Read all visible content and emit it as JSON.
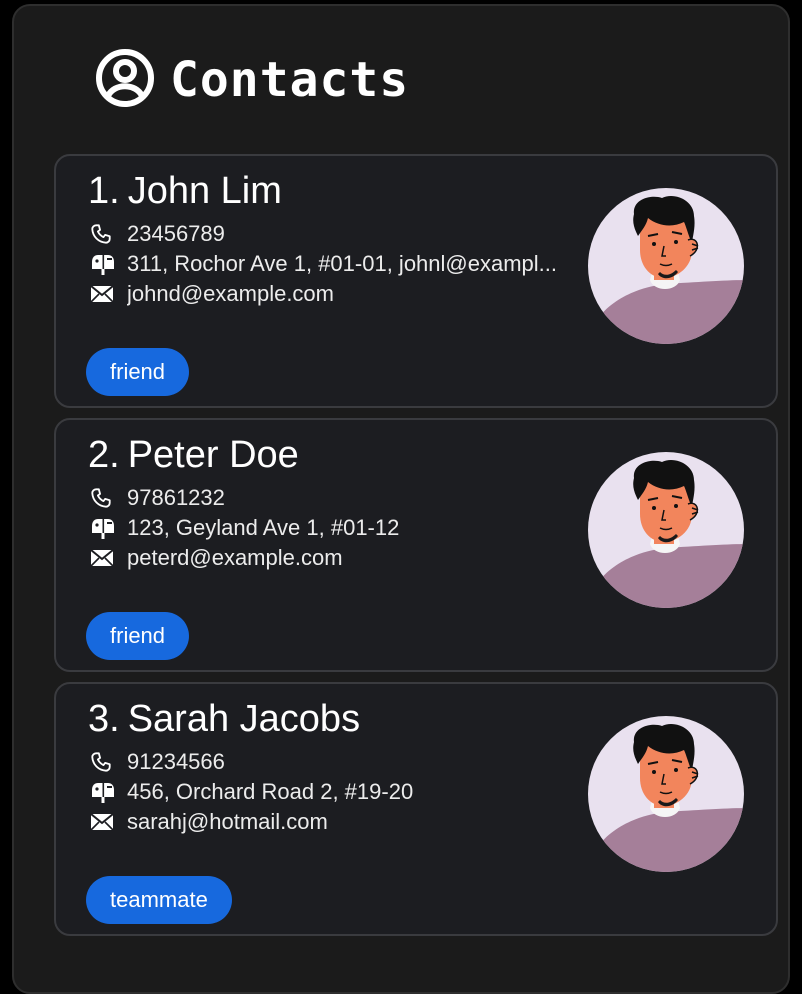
{
  "header": {
    "title": "Contacts",
    "icon": "user-circle-icon"
  },
  "contacts": [
    {
      "index": "1.",
      "name": "John Lim",
      "phone": "23456789",
      "address": "311, Rochor Ave 1, #01-01, johnl@exampl...",
      "email": "johnd@example.com",
      "tag": "friend"
    },
    {
      "index": "2.",
      "name": "Peter Doe",
      "phone": "97861232",
      "address": "123, Geyland Ave 1, #01-12",
      "email": "peterd@example.com",
      "tag": "friend"
    },
    {
      "index": "3.",
      "name": "Sarah Jacobs",
      "phone": "91234566",
      "address": "456, Orchard Road 2, #19-20",
      "email": "sarahj@hotmail.com",
      "tag": "teammate"
    }
  ],
  "colors": {
    "background": "#1b1b1b",
    "card": "#1c1d21",
    "tag": "#1769de",
    "avatar_bg": "#e9e1ef",
    "avatar_shirt": "#a57f99",
    "avatar_skin": "#f2855c"
  }
}
